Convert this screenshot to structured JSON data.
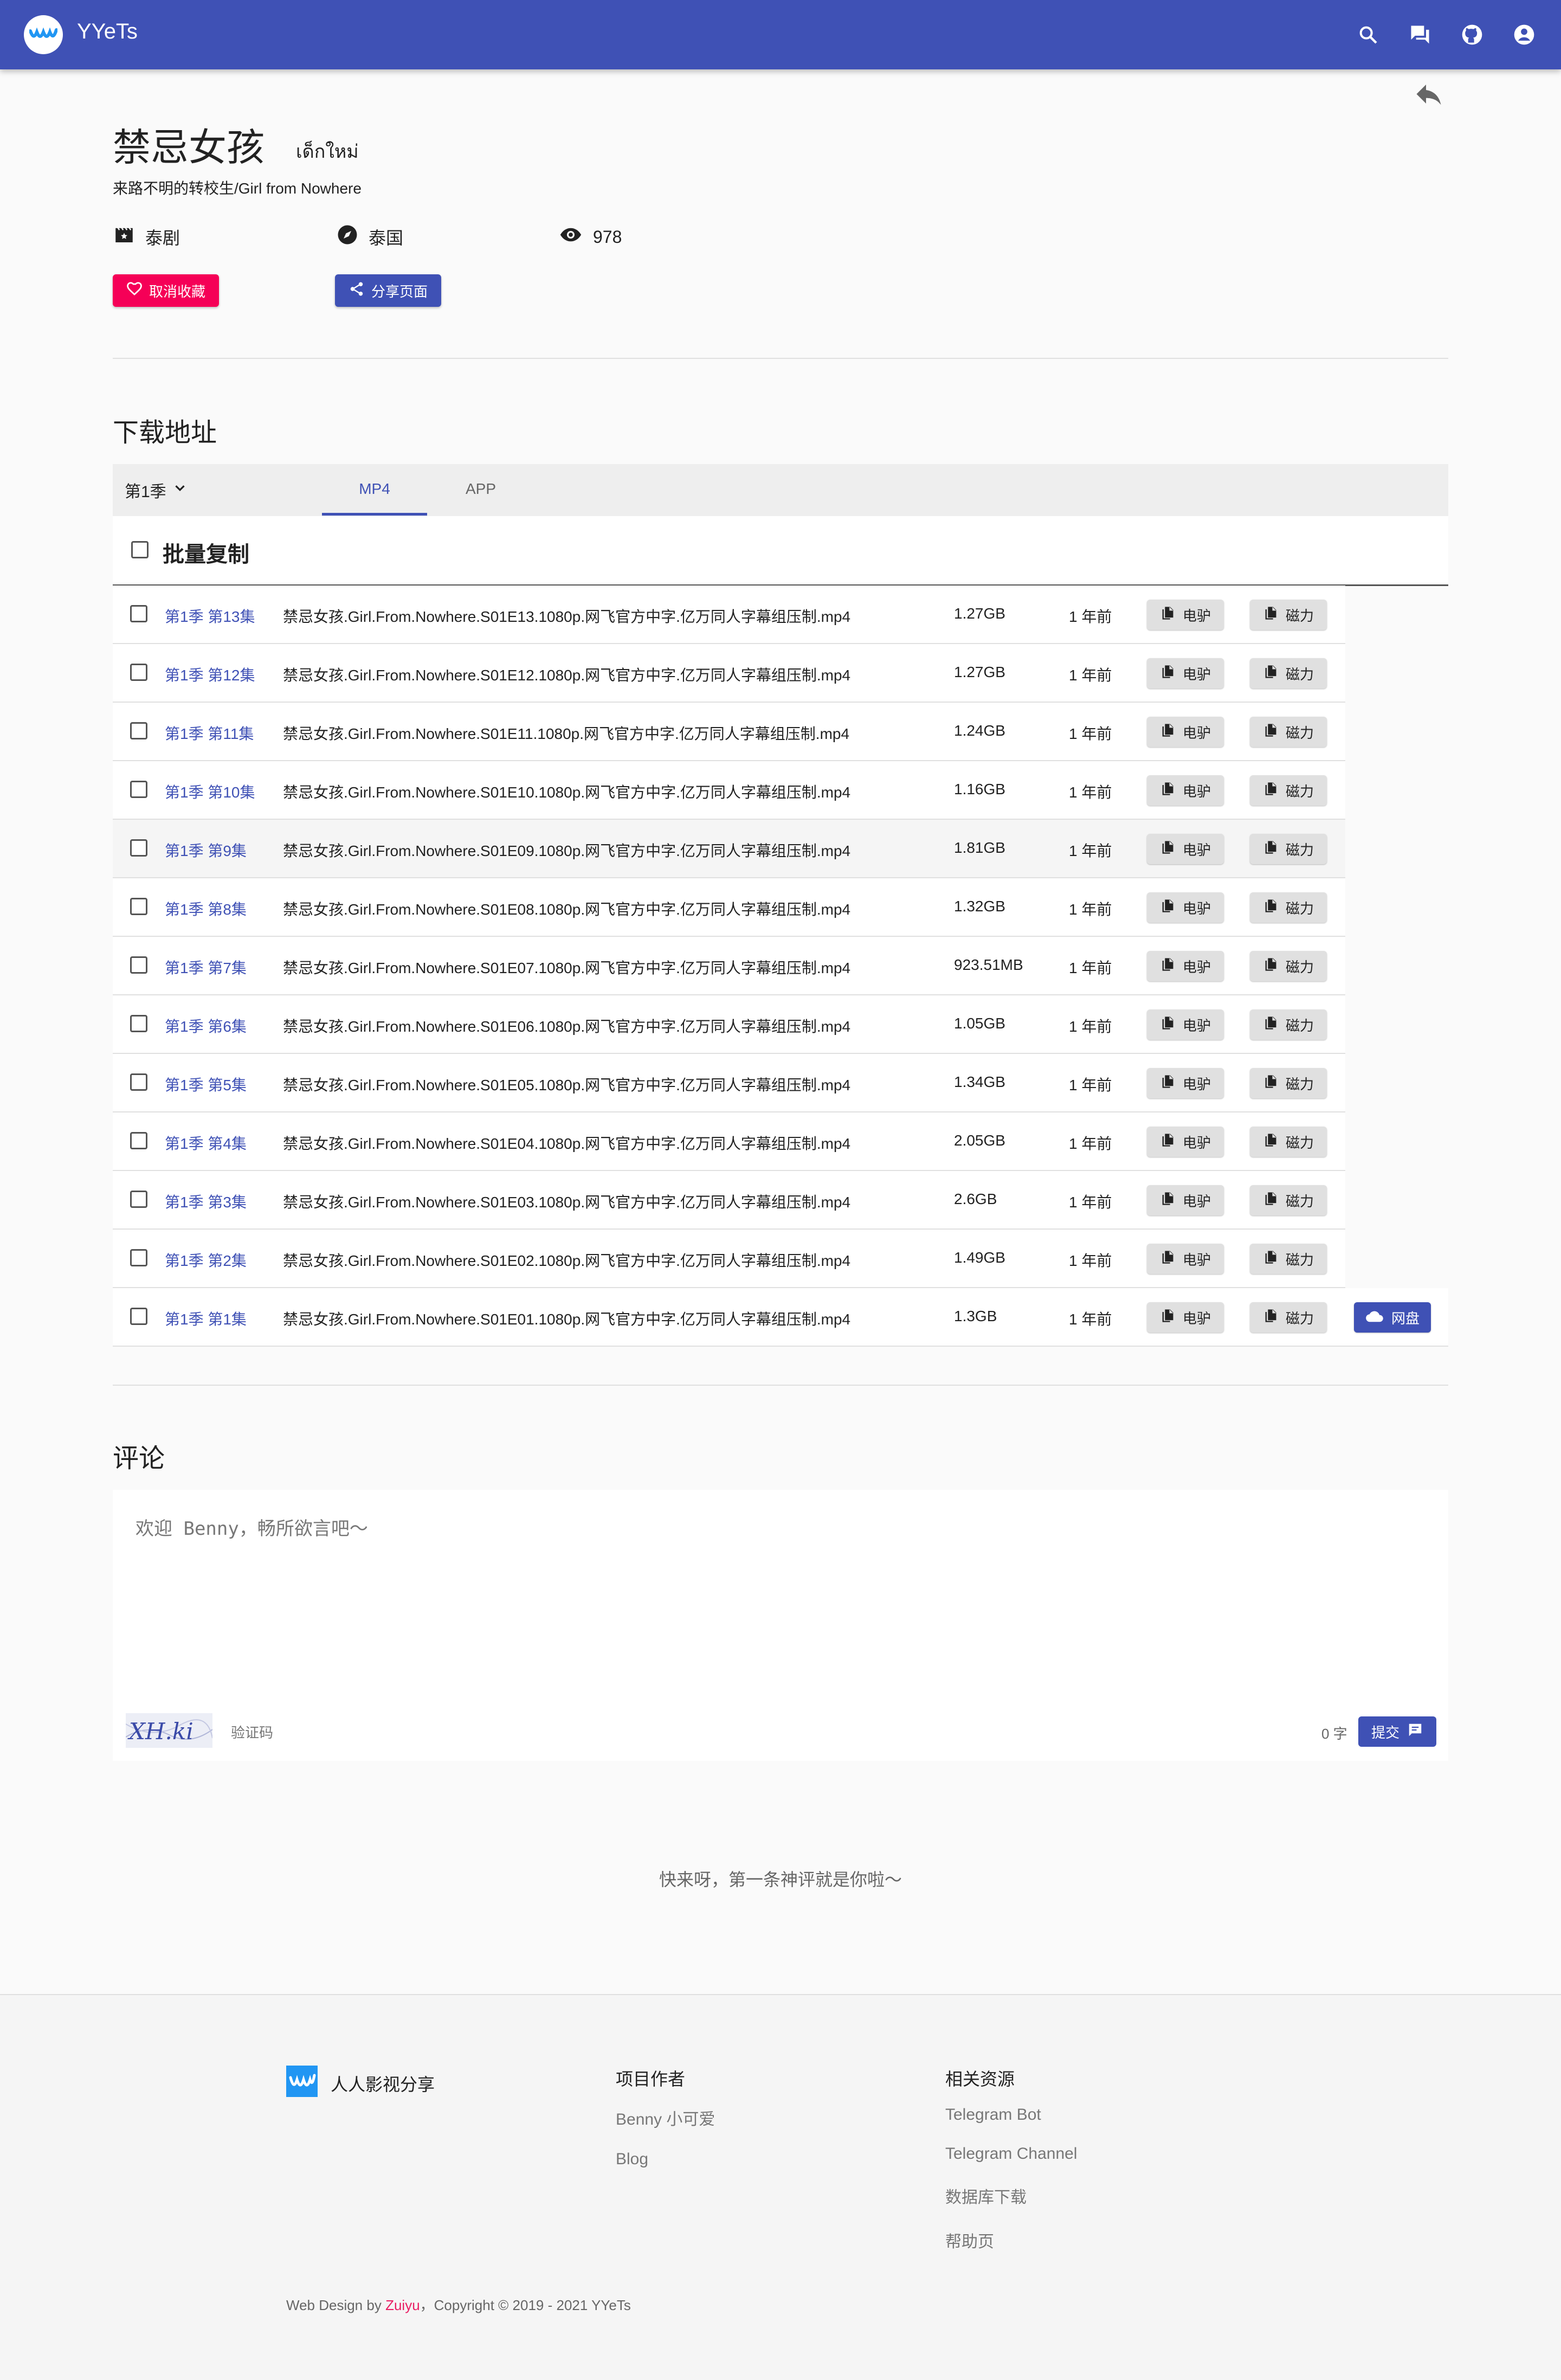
{
  "app": {
    "title": "YYeTs"
  },
  "resource": {
    "title": "禁忌女孩",
    "original_title": "เด็กใหม่",
    "aliases": "来路不明的转校生/Girl from Nowhere",
    "category": "泰剧",
    "area": "泰国",
    "views": "978",
    "favorite_label": "取消收藏",
    "share_label": "分享页面"
  },
  "downloads": {
    "heading": "下载地址",
    "season": "第1季",
    "tabs": [
      "MP4",
      "APP"
    ],
    "batch_copy": "批量复制",
    "ed2k_label": "电驴",
    "magnet_label": "磁力",
    "cloud_label": "网盘",
    "rows": [
      {
        "ep": "第1季 第13集",
        "file": "禁忌女孩.Girl.From.Nowhere.S01E13.1080p.网飞官方中字.亿万同人字幕组压制.mp4",
        "size": "1.27GB",
        "time": "1 年前"
      },
      {
        "ep": "第1季 第12集",
        "file": "禁忌女孩.Girl.From.Nowhere.S01E12.1080p.网飞官方中字.亿万同人字幕组压制.mp4",
        "size": "1.27GB",
        "time": "1 年前"
      },
      {
        "ep": "第1季 第11集",
        "file": "禁忌女孩.Girl.From.Nowhere.S01E11.1080p.网飞官方中字.亿万同人字幕组压制.mp4",
        "size": "1.24GB",
        "time": "1 年前"
      },
      {
        "ep": "第1季 第10集",
        "file": "禁忌女孩.Girl.From.Nowhere.S01E10.1080p.网飞官方中字.亿万同人字幕组压制.mp4",
        "size": "1.16GB",
        "time": "1 年前"
      },
      {
        "ep": "第1季 第9集",
        "file": "禁忌女孩.Girl.From.Nowhere.S01E09.1080p.网飞官方中字.亿万同人字幕组压制.mp4",
        "size": "1.81GB",
        "time": "1 年前"
      },
      {
        "ep": "第1季 第8集",
        "file": "禁忌女孩.Girl.From.Nowhere.S01E08.1080p.网飞官方中字.亿万同人字幕组压制.mp4",
        "size": "1.32GB",
        "time": "1 年前"
      },
      {
        "ep": "第1季 第7集",
        "file": "禁忌女孩.Girl.From.Nowhere.S01E07.1080p.网飞官方中字.亿万同人字幕组压制.mp4",
        "size": "923.51MB",
        "time": "1 年前"
      },
      {
        "ep": "第1季 第6集",
        "file": "禁忌女孩.Girl.From.Nowhere.S01E06.1080p.网飞官方中字.亿万同人字幕组压制.mp4",
        "size": "1.05GB",
        "time": "1 年前"
      },
      {
        "ep": "第1季 第5集",
        "file": "禁忌女孩.Girl.From.Nowhere.S01E05.1080p.网飞官方中字.亿万同人字幕组压制.mp4",
        "size": "1.34GB",
        "time": "1 年前"
      },
      {
        "ep": "第1季 第4集",
        "file": "禁忌女孩.Girl.From.Nowhere.S01E04.1080p.网飞官方中字.亿万同人字幕组压制.mp4",
        "size": "2.05GB",
        "time": "1 年前"
      },
      {
        "ep": "第1季 第3集",
        "file": "禁忌女孩.Girl.From.Nowhere.S01E03.1080p.网飞官方中字.亿万同人字幕组压制.mp4",
        "size": "2.6GB",
        "time": "1 年前"
      },
      {
        "ep": "第1季 第2集",
        "file": "禁忌女孩.Girl.From.Nowhere.S01E02.1080p.网飞官方中字.亿万同人字幕组压制.mp4",
        "size": "1.49GB",
        "time": "1 年前"
      },
      {
        "ep": "第1季 第1集",
        "file": "禁忌女孩.Girl.From.Nowhere.S01E01.1080p.网飞官方中字.亿万同人字幕组压制.mp4",
        "size": "1.3GB",
        "time": "1 年前"
      }
    ]
  },
  "comments": {
    "heading": "评论",
    "placeholder": "欢迎 Benny，畅所欲言吧～",
    "captcha_text": "XH.ki",
    "captcha_label": "验证码",
    "char_count": "0 字",
    "submit_label": "提交",
    "empty": "快来呀，第一条神评就是你啦～"
  },
  "footer": {
    "brand": "人人影视分享",
    "col1_title": "项目作者",
    "col1_links": [
      "Benny 小可爱",
      "Blog"
    ],
    "col2_title": "相关资源",
    "col2_links": [
      "Telegram Bot",
      "Telegram Channel",
      "数据库下载",
      "帮助页"
    ],
    "copyright_prefix": "Web Design by",
    "copyright_author": "Zuiyu",
    "copyright_suffix": "，Copyright © 2019 - 2021 YYeTs"
  },
  "colors": {
    "primary": "#3f51b5",
    "accent": "#f50057"
  }
}
